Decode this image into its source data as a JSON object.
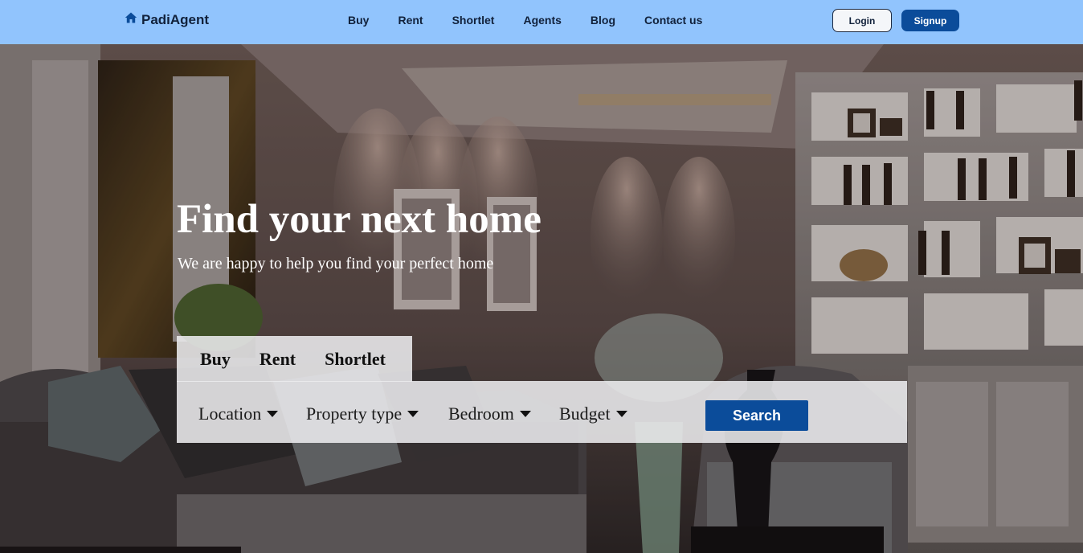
{
  "nav": {
    "brand": "PadiAgent",
    "links": [
      "Buy",
      "Rent",
      "Shortlet",
      "Agents",
      "Blog",
      "Contact us"
    ],
    "login": "Login",
    "signup": "Signup"
  },
  "hero": {
    "title": "Find your next home",
    "subtitle": "We are happy to help you find your perfect home",
    "tabs": [
      "Buy",
      "Rent",
      "Shortlet"
    ],
    "filters": {
      "location": "Location",
      "property_type": "Property type",
      "bedroom": "Bedroom",
      "budget": "Budget"
    },
    "search_label": "Search"
  },
  "colors": {
    "navbar": "#91c4fd",
    "accent": "#0b4c9a",
    "brand_text": "#11213b"
  },
  "icons": {
    "brand": "home-icon",
    "filter_caret": "caret-down-icon"
  }
}
